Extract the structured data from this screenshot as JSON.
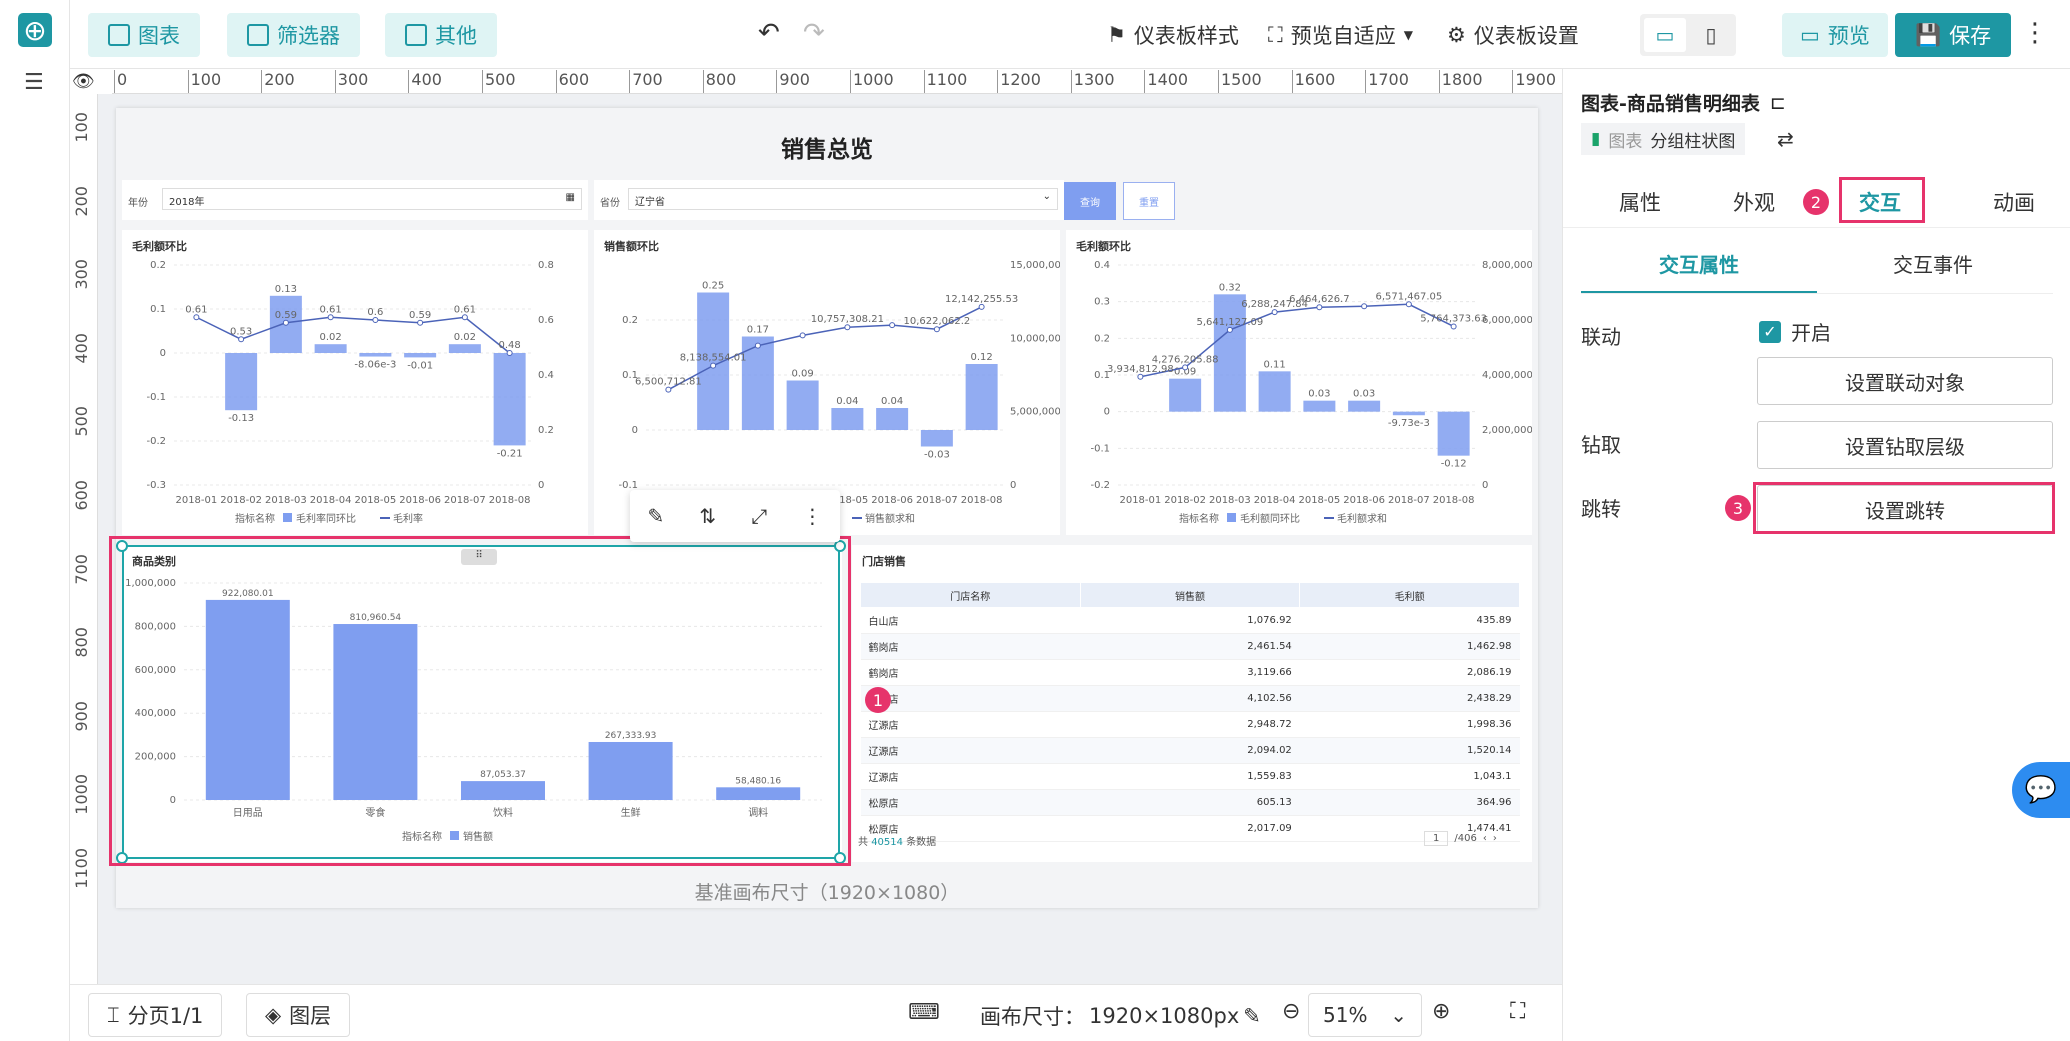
{
  "toolbar": {
    "chart_label": "图表",
    "filter_label": "筛选器",
    "other_label": "其他",
    "style_label": "仪表板样式",
    "adaptive_label": "预览自适应",
    "settings_label": "仪表板设置",
    "preview_label": "预览",
    "save_label": "保存"
  },
  "ruler": {
    "h_ticks": [
      "0",
      "100",
      "200",
      "300",
      "400",
      "500",
      "600",
      "700",
      "800",
      "900",
      "1000",
      "1100",
      "1200",
      "1300",
      "1400",
      "1500",
      "1600",
      "1700",
      "1800",
      "1900"
    ],
    "v_ticks": [
      "100",
      "200",
      "300",
      "400",
      "500",
      "600",
      "700",
      "800",
      "900",
      "1000",
      "1100"
    ]
  },
  "dashboard": {
    "title": "销售总览",
    "canvas_note": "基准画布尺寸（1920×1080）",
    "filter_year_label": "年份",
    "filter_year_value": "2018年",
    "filter_province_label": "省份",
    "filter_province_value": "辽宁省",
    "query_label": "查询",
    "reset_label": "重置",
    "legend_prefix": "指标名称",
    "chart1_title": "毛利额环比",
    "chart1_legend": [
      "毛利率同环比",
      "毛利率"
    ],
    "chart2_title": "销售额环比",
    "chart2_legend": [
      "销售额同环比",
      "销售额求和"
    ],
    "chart3_title": "毛利额环比",
    "chart3_legend": [
      "毛利额同环比",
      "毛利额求和"
    ],
    "chart4_title": "商品类别",
    "chart4_legend": [
      "销售额"
    ],
    "table_title": "门店销售",
    "table_headers": [
      "门店名称",
      "销售额",
      "毛利额"
    ],
    "table_rows": [
      [
        "白山店",
        "1,076.92",
        "435.89"
      ],
      [
        "鹤岗店",
        "2,461.54",
        "1,462.98"
      ],
      [
        "鹤岗店",
        "3,119.66",
        "2,086.19"
      ],
      [
        "鹤岗店",
        "4,102.56",
        "2,438.29"
      ],
      [
        "辽源店",
        "2,948.72",
        "1,998.36"
      ],
      [
        "辽源店",
        "2,094.02",
        "1,520.14"
      ],
      [
        "辽源店",
        "1,559.83",
        "1,043.1"
      ],
      [
        "松原店",
        "605.13",
        "364.96"
      ],
      [
        "松原店",
        "2,017.09",
        "1,474.41"
      ]
    ],
    "table_footer_prefix": "共",
    "table_footer_count": "40514",
    "table_footer_suffix": "条数据",
    "table_page": "1",
    "table_pages": "/406"
  },
  "chart_data": [
    {
      "type": "bar",
      "title": "毛利额环比",
      "categories": [
        "2018-01",
        "2018-02",
        "2018-03",
        "2018-04",
        "2018-05",
        "2018-06",
        "2018-07",
        "2018-08"
      ],
      "series": [
        {
          "name": "毛利率同环比",
          "type": "bar",
          "values": [
            null,
            -0.13,
            0.13,
            0.02,
            -0.00806,
            -0.01,
            0.02,
            -0.21
          ],
          "labels": [
            "",
            "-0.13",
            "0.13",
            "0.02",
            "-8.06e-3",
            "-0.01",
            "0.02",
            "-0.21"
          ]
        },
        {
          "name": "毛利率",
          "type": "line",
          "values": [
            0.61,
            0.53,
            0.59,
            0.61,
            0.6,
            0.59,
            0.61,
            0.48
          ]
        }
      ],
      "ylim_left": [
        -0.3,
        0.2
      ],
      "yticks_left": [
        "0.2",
        "0.1",
        "0",
        "-0.1",
        "-0.2",
        "-0.3"
      ],
      "ylim_right": [
        0,
        0.8
      ],
      "yticks_right": [
        "0.8",
        "0.6",
        "0.4",
        "0.2",
        "0"
      ]
    },
    {
      "type": "bar",
      "title": "销售额环比",
      "categories": [
        "2018-01",
        "2018-02",
        "2018-03",
        "2018-04",
        "2018-05",
        "2018-06",
        "2018-07",
        "2018-08"
      ],
      "series": [
        {
          "name": "销售额同环比",
          "type": "bar",
          "values": [
            null,
            0.25,
            0.17,
            0.09,
            0.04,
            0.04,
            -0.03,
            0.12
          ]
        },
        {
          "name": "销售额求和",
          "type": "line",
          "values": [
            6500712.81,
            8138554.01,
            9500000,
            10200000,
            10757308.21,
            10900000,
            10622062.2,
            12142255.53
          ],
          "labels": [
            "6,500,712.81",
            "8,138,554.01",
            "",
            "",
            "10,757,308.21",
            "",
            "10,622,062.2",
            "12,142,255.53"
          ]
        }
      ],
      "ylim_left": [
        -0.1,
        0.3
      ],
      "yticks_left": [
        "0.2",
        "0.1",
        "0",
        "-0.1"
      ],
      "ylim_right": [
        0,
        15000000
      ],
      "yticks_right": [
        "15,000,000",
        "10,000,000",
        "5,000,000",
        "0"
      ]
    },
    {
      "type": "bar",
      "title": "毛利额环比",
      "categories": [
        "2018-01",
        "2018-02",
        "2018-03",
        "2018-04",
        "2018-05",
        "2018-06",
        "2018-07",
        "2018-08"
      ],
      "series": [
        {
          "name": "毛利额同环比",
          "type": "bar",
          "values": [
            null,
            0.09,
            0.32,
            0.11,
            0.03,
            0.03,
            -0.00973,
            -0.12
          ],
          "labels": [
            "",
            "0.09",
            "0.32",
            "0.11",
            "0.03",
            "0.03",
            "-9.73e-3",
            "-0.12"
          ]
        },
        {
          "name": "毛利额求和",
          "type": "line",
          "values": [
            3934812.98,
            4276205.88,
            5641127.09,
            6288247.84,
            6464626.7,
            6500000,
            6571467.05,
            5764373.63
          ],
          "labels": [
            "3,934,812.98",
            "4,276,205.88",
            "5,641,127.09",
            "6,288,247.84",
            "6,464,626.7",
            "",
            "6,571,467.05",
            "5,764,373.63"
          ]
        }
      ],
      "ylim_left": [
        -0.2,
        0.4
      ],
      "yticks_left": [
        "0.4",
        "0.3",
        "0.2",
        "0.1",
        "0",
        "-0.1",
        "-0.2"
      ],
      "ylim_right": [
        0,
        8000000
      ],
      "yticks_right": [
        "8,000,000",
        "6,000,000",
        "4,000,000",
        "2,000,000",
        "0"
      ]
    },
    {
      "type": "bar",
      "title": "商品类别",
      "categories": [
        "日用品",
        "零食",
        "饮料",
        "生鲜",
        "调料"
      ],
      "series": [
        {
          "name": "销售额",
          "values": [
            922080.01,
            810960.54,
            87053.37,
            267333.93,
            58480.16
          ],
          "labels": [
            "922,080.01",
            "810,960.54",
            "87,053.37",
            "267,333.93",
            "58,480.16"
          ]
        }
      ],
      "ylim": [
        0,
        1000000
      ],
      "yticks": [
        "1,000,000",
        "800,000",
        "600,000",
        "400,000",
        "200,000",
        "0"
      ]
    }
  ],
  "float_toolbar": {
    "icons": [
      "edit-icon",
      "swap-icon",
      "expand-icon",
      "more-icon"
    ]
  },
  "panel": {
    "title": "图表-商品销售明细表",
    "type_prefix": "图表",
    "type_name": "分组柱状图",
    "tabs": [
      "属性",
      "外观",
      "交互",
      "动画"
    ],
    "subtabs": [
      "交互属性",
      "交互事件"
    ],
    "link_label": "联动",
    "link_toggle": "开启",
    "link_btn": "设置联动对象",
    "drill_label": "钻取",
    "drill_btn": "设置钻取层级",
    "jump_label": "跳转",
    "jump_btn": "设置跳转",
    "badges": [
      "1",
      "2",
      "3"
    ]
  },
  "bottom": {
    "page_label": "分页1/1",
    "layer_label": "图层",
    "canvas_size_prefix": "画布尺寸：",
    "canvas_size": "1920×1080px",
    "zoom": "51%"
  },
  "colors": {
    "accent": "#1e97a3",
    "bar": "#7f9ef0",
    "line": "#4b63b8",
    "highlight": "#e6336b"
  }
}
